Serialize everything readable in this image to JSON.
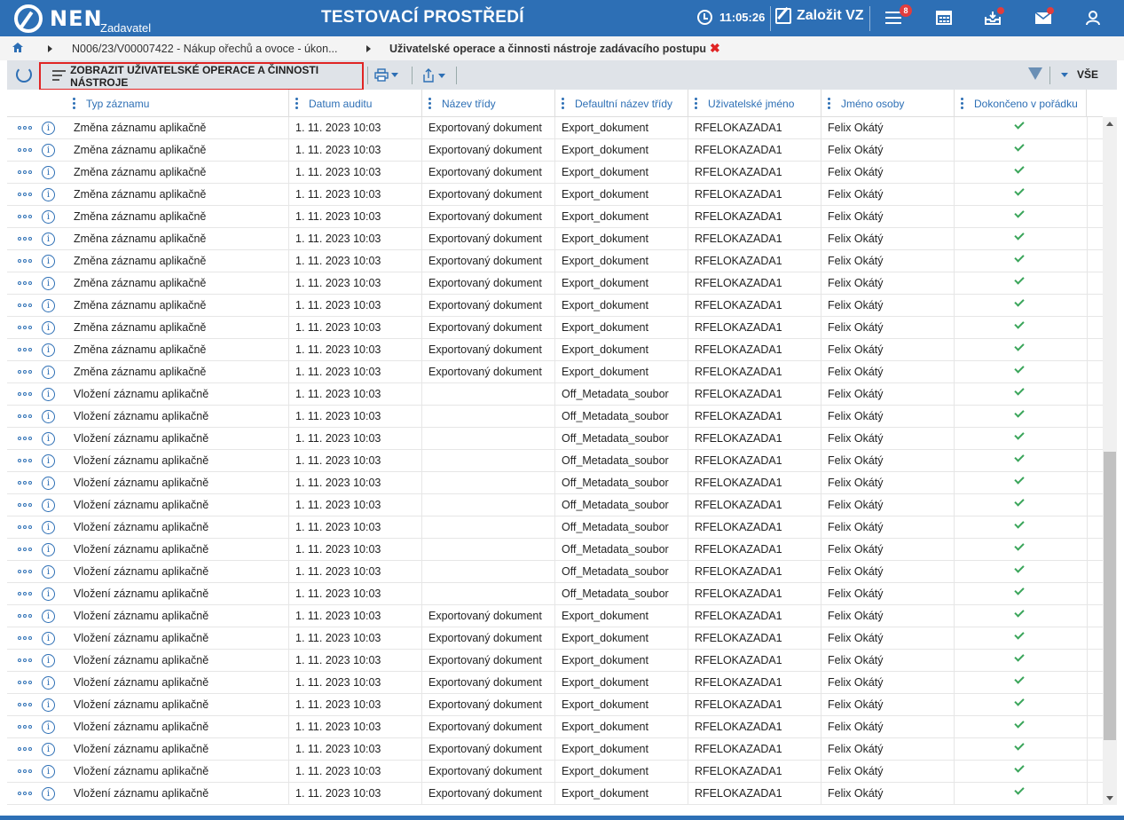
{
  "header": {
    "brand": "NEN",
    "brand_sub": "Zadavatel",
    "env_title": "TESTOVACÍ PROSTŘEDÍ",
    "time": "11:05:26",
    "create_label": "Založit VZ",
    "notifications_count": "8"
  },
  "breadcrumb": {
    "items": [
      "N006/23/V00007422 - Nákup ořechů a ovoce - úkon...",
      "Uživatelské operace a činnosti nástroje zadávacího postupu"
    ],
    "close_glyph": "✖"
  },
  "toolbar": {
    "show_label": "ZOBRAZIT UŽIVATELSKÉ OPERACE A ČINNOSTI NÁSTROJE",
    "filter_scope": "VŠE"
  },
  "table": {
    "columns": [
      "Typ záznamu",
      "Datum auditu",
      "Název třídy",
      "Defaultní název třídy",
      "Uživatelské jméno",
      "Jméno osoby",
      "Dokončeno v pořádku"
    ],
    "rows": [
      [
        "Změna záznamu aplikačně",
        "1. 11. 2023 10:03",
        "Exportovaný dokument",
        "Export_dokument",
        "RFELOKAZADA1",
        "Felix Okátý",
        true
      ],
      [
        "Změna záznamu aplikačně",
        "1. 11. 2023 10:03",
        "Exportovaný dokument",
        "Export_dokument",
        "RFELOKAZADA1",
        "Felix Okátý",
        true
      ],
      [
        "Změna záznamu aplikačně",
        "1. 11. 2023 10:03",
        "Exportovaný dokument",
        "Export_dokument",
        "RFELOKAZADA1",
        "Felix Okátý",
        true
      ],
      [
        "Změna záznamu aplikačně",
        "1. 11. 2023 10:03",
        "Exportovaný dokument",
        "Export_dokument",
        "RFELOKAZADA1",
        "Felix Okátý",
        true
      ],
      [
        "Změna záznamu aplikačně",
        "1. 11. 2023 10:03",
        "Exportovaný dokument",
        "Export_dokument",
        "RFELOKAZADA1",
        "Felix Okátý",
        true
      ],
      [
        "Změna záznamu aplikačně",
        "1. 11. 2023 10:03",
        "Exportovaný dokument",
        "Export_dokument",
        "RFELOKAZADA1",
        "Felix Okátý",
        true
      ],
      [
        "Změna záznamu aplikačně",
        "1. 11. 2023 10:03",
        "Exportovaný dokument",
        "Export_dokument",
        "RFELOKAZADA1",
        "Felix Okátý",
        true
      ],
      [
        "Změna záznamu aplikačně",
        "1. 11. 2023 10:03",
        "Exportovaný dokument",
        "Export_dokument",
        "RFELOKAZADA1",
        "Felix Okátý",
        true
      ],
      [
        "Změna záznamu aplikačně",
        "1. 11. 2023 10:03",
        "Exportovaný dokument",
        "Export_dokument",
        "RFELOKAZADA1",
        "Felix Okátý",
        true
      ],
      [
        "Změna záznamu aplikačně",
        "1. 11. 2023 10:03",
        "Exportovaný dokument",
        "Export_dokument",
        "RFELOKAZADA1",
        "Felix Okátý",
        true
      ],
      [
        "Změna záznamu aplikačně",
        "1. 11. 2023 10:03",
        "Exportovaný dokument",
        "Export_dokument",
        "RFELOKAZADA1",
        "Felix Okátý",
        true
      ],
      [
        "Změna záznamu aplikačně",
        "1. 11. 2023 10:03",
        "Exportovaný dokument",
        "Export_dokument",
        "RFELOKAZADA1",
        "Felix Okátý",
        true
      ],
      [
        "Vložení záznamu aplikačně",
        "1. 11. 2023 10:03",
        "",
        "Off_Metadata_soubor",
        "RFELOKAZADA1",
        "Felix Okátý",
        true
      ],
      [
        "Vložení záznamu aplikačně",
        "1. 11. 2023 10:03",
        "",
        "Off_Metadata_soubor",
        "RFELOKAZADA1",
        "Felix Okátý",
        true
      ],
      [
        "Vložení záznamu aplikačně",
        "1. 11. 2023 10:03",
        "",
        "Off_Metadata_soubor",
        "RFELOKAZADA1",
        "Felix Okátý",
        true
      ],
      [
        "Vložení záznamu aplikačně",
        "1. 11. 2023 10:03",
        "",
        "Off_Metadata_soubor",
        "RFELOKAZADA1",
        "Felix Okátý",
        true
      ],
      [
        "Vložení záznamu aplikačně",
        "1. 11. 2023 10:03",
        "",
        "Off_Metadata_soubor",
        "RFELOKAZADA1",
        "Felix Okátý",
        true
      ],
      [
        "Vložení záznamu aplikačně",
        "1. 11. 2023 10:03",
        "",
        "Off_Metadata_soubor",
        "RFELOKAZADA1",
        "Felix Okátý",
        true
      ],
      [
        "Vložení záznamu aplikačně",
        "1. 11. 2023 10:03",
        "",
        "Off_Metadata_soubor",
        "RFELOKAZADA1",
        "Felix Okátý",
        true
      ],
      [
        "Vložení záznamu aplikačně",
        "1. 11. 2023 10:03",
        "",
        "Off_Metadata_soubor",
        "RFELOKAZADA1",
        "Felix Okátý",
        true
      ],
      [
        "Vložení záznamu aplikačně",
        "1. 11. 2023 10:03",
        "",
        "Off_Metadata_soubor",
        "RFELOKAZADA1",
        "Felix Okátý",
        true
      ],
      [
        "Vložení záznamu aplikačně",
        "1. 11. 2023 10:03",
        "",
        "Off_Metadata_soubor",
        "RFELOKAZADA1",
        "Felix Okátý",
        true
      ],
      [
        "Vložení záznamu aplikačně",
        "1. 11. 2023 10:03",
        "Exportovaný dokument",
        "Export_dokument",
        "RFELOKAZADA1",
        "Felix Okátý",
        true
      ],
      [
        "Vložení záznamu aplikačně",
        "1. 11. 2023 10:03",
        "Exportovaný dokument",
        "Export_dokument",
        "RFELOKAZADA1",
        "Felix Okátý",
        true
      ],
      [
        "Vložení záznamu aplikačně",
        "1. 11. 2023 10:03",
        "Exportovaný dokument",
        "Export_dokument",
        "RFELOKAZADA1",
        "Felix Okátý",
        true
      ],
      [
        "Vložení záznamu aplikačně",
        "1. 11. 2023 10:03",
        "Exportovaný dokument",
        "Export_dokument",
        "RFELOKAZADA1",
        "Felix Okátý",
        true
      ],
      [
        "Vložení záznamu aplikačně",
        "1. 11. 2023 10:03",
        "Exportovaný dokument",
        "Export_dokument",
        "RFELOKAZADA1",
        "Felix Okátý",
        true
      ],
      [
        "Vložení záznamu aplikačně",
        "1. 11. 2023 10:03",
        "Exportovaný dokument",
        "Export_dokument",
        "RFELOKAZADA1",
        "Felix Okátý",
        true
      ],
      [
        "Vložení záznamu aplikačně",
        "1. 11. 2023 10:03",
        "Exportovaný dokument",
        "Export_dokument",
        "RFELOKAZADA1",
        "Felix Okátý",
        true
      ],
      [
        "Vložení záznamu aplikačně",
        "1. 11. 2023 10:03",
        "Exportovaný dokument",
        "Export_dokument",
        "RFELOKAZADA1",
        "Felix Okátý",
        true
      ],
      [
        "Vložení záznamu aplikačně",
        "1. 11. 2023 10:03",
        "Exportovaný dokument",
        "Export_dokument",
        "RFELOKAZADA1",
        "Felix Okátý",
        true
      ]
    ]
  },
  "colors": {
    "brand_blue": "#2d6fb5",
    "alert_red": "#e02424",
    "ok_green": "#3aa55a"
  },
  "icons": {
    "menu": "menu-icon",
    "calendar": "calendar-icon",
    "inbox": "inbox-icon",
    "mail": "mail-icon",
    "user": "user-icon"
  }
}
